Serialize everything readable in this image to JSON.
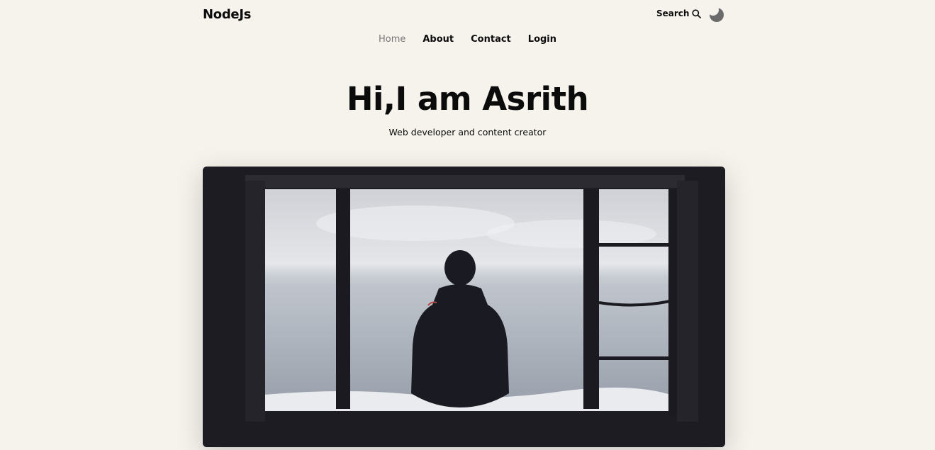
{
  "header": {
    "logo": "NodeJs",
    "search_label": "Search",
    "search_icon": "search-icon",
    "theme_icon": "moon-icon"
  },
  "nav": {
    "items": [
      {
        "label": "Home",
        "active": true
      },
      {
        "label": "About",
        "active": false
      },
      {
        "label": "Contact",
        "active": false
      },
      {
        "label": "Login",
        "active": false
      }
    ]
  },
  "hero": {
    "title": "Hi,I am Asrith",
    "subtitle": "Web developer and content creator"
  },
  "colors": {
    "background": "#f6f2ec",
    "text": "#0b0b0b",
    "muted": "#777777",
    "moon": "#6b6b6b",
    "image_frame": "#1d1c22"
  }
}
